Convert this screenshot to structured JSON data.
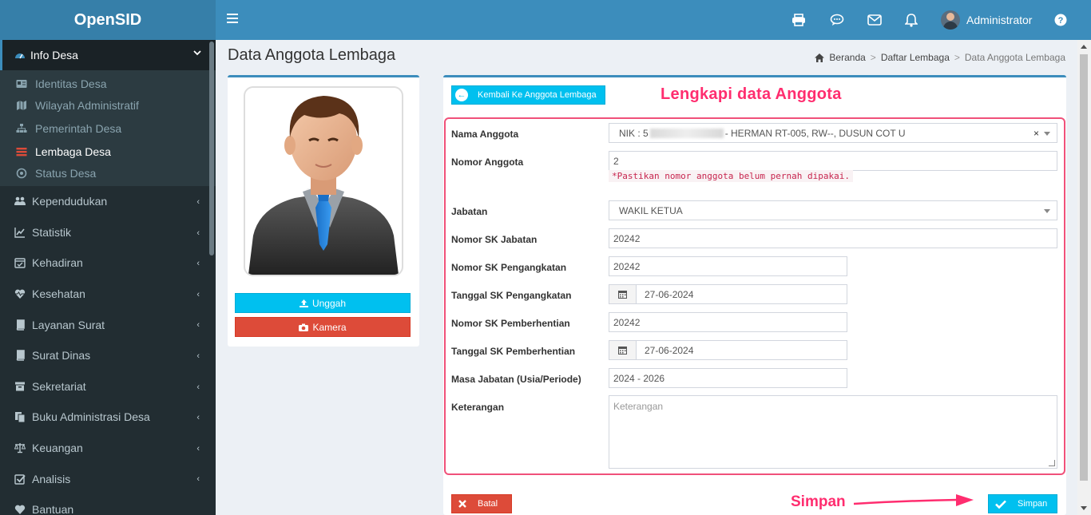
{
  "app": {
    "title": "OpenSID"
  },
  "header": {
    "user_name": "Administrator"
  },
  "sidebar": {
    "active": {
      "label": "Info Desa"
    },
    "sub_items": [
      {
        "label": "Identitas Desa",
        "icon": "id-card-icon"
      },
      {
        "label": "Wilayah Administratif",
        "icon": "map-icon"
      },
      {
        "label": "Pemerintah Desa",
        "icon": "sitemap-icon"
      },
      {
        "label": "Lembaga Desa",
        "icon": "list-icon"
      },
      {
        "label": "Status Desa",
        "icon": "dot-circle-icon"
      }
    ],
    "items": [
      {
        "label": "Kependudukan",
        "icon": "users-icon"
      },
      {
        "label": "Statistik",
        "icon": "line-chart-icon"
      },
      {
        "label": "Kehadiran",
        "icon": "calendar-check-icon"
      },
      {
        "label": "Kesehatan",
        "icon": "heartbeat-icon"
      },
      {
        "label": "Layanan Surat",
        "icon": "book-icon"
      },
      {
        "label": "Surat Dinas",
        "icon": "book-icon"
      },
      {
        "label": "Sekretariat",
        "icon": "archive-icon"
      },
      {
        "label": "Buku Administrasi Desa",
        "icon": "copy-icon"
      },
      {
        "label": "Keuangan",
        "icon": "balance-scale-icon"
      },
      {
        "label": "Analisis",
        "icon": "check-square-icon"
      },
      {
        "label": "Bantuan",
        "icon": "heart-icon"
      }
    ]
  },
  "page": {
    "title": "Data Anggota Lembaga",
    "breadcrumb": [
      "Beranda",
      "Daftar Lembaga",
      "Data Anggota Lembaga"
    ]
  },
  "photo_panel": {
    "upload_label": "Unggah",
    "camera_label": "Kamera"
  },
  "form": {
    "back_label": "Kembali Ke Anggota Lembaga",
    "annotation_title": "Lengkapi data Anggota",
    "nama_anggota": {
      "label": "Nama Anggota",
      "prefix": "NIK : 5",
      "suffix": "- HERMAN RT-005, RW--, DUSUN COT U"
    },
    "nomor_anggota": {
      "label": "Nomor Anggota",
      "value": "2",
      "hint": "*Pastikan nomor anggota belum pernah dipakai."
    },
    "jabatan": {
      "label": "Jabatan",
      "value": "WAKIL KETUA"
    },
    "nomor_sk_jabatan": {
      "label": "Nomor SK Jabatan",
      "value": "20242"
    },
    "nomor_sk_pengangkatan": {
      "label": "Nomor SK Pengangkatan",
      "value": "20242"
    },
    "tanggal_sk_pengangkatan": {
      "label": "Tanggal SK Pengangkatan",
      "value": "27-06-2024"
    },
    "nomor_sk_pemberhentian": {
      "label": "Nomor SK Pemberhentian",
      "value": "20242"
    },
    "tanggal_sk_pemberhentian": {
      "label": "Tanggal SK Pemberhentian",
      "value": "27-06-2024"
    },
    "masa_jabatan": {
      "label": "Masa Jabatan (Usia/Periode)",
      "value": "2024 - 2026"
    },
    "keterangan": {
      "label": "Keterangan",
      "placeholder": "Keterangan"
    },
    "batal_label": "Batal",
    "simpan_label": "Simpan",
    "annotation_simpan": "Simpan"
  }
}
